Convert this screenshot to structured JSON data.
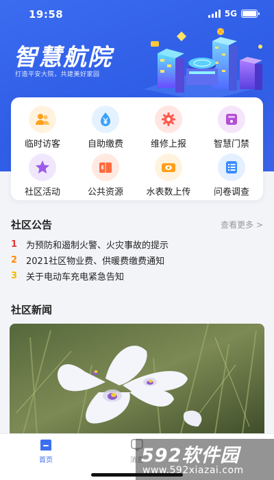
{
  "status": {
    "time": "19:58",
    "network": "5G"
  },
  "header": {
    "title": "智慧航院",
    "slogan": "打造平安大院，共建美好家园"
  },
  "quick_actions": [
    {
      "label": "临时访客",
      "icon": "visitor-icon",
      "color": "#ff9f1a",
      "bg": "#fff3df"
    },
    {
      "label": "自助缴费",
      "icon": "yen-payment-icon",
      "color": "#3aa1ff",
      "bg": "#e4f2ff"
    },
    {
      "label": "维修上报",
      "icon": "repair-gear-icon",
      "color": "#ff5a4e",
      "bg": "#ffe6e3"
    },
    {
      "label": "智慧门禁",
      "icon": "access-door-icon",
      "color": "#b34fd6",
      "bg": "#f5e5fb"
    },
    {
      "label": "社区活动",
      "icon": "star-activity-icon",
      "color": "#9c5ce8",
      "bg": "#f0e7fd"
    },
    {
      "label": "公共资源",
      "icon": "book-resource-icon",
      "color": "#ff6a3d",
      "bg": "#ffe9e0"
    },
    {
      "label": "水表数上传",
      "icon": "meter-icon",
      "color": "#ff9f1a",
      "bg": "#fff3df"
    },
    {
      "label": "问卷调查",
      "icon": "survey-list-icon",
      "color": "#3a8dff",
      "bg": "#e4efff"
    }
  ],
  "notices": {
    "title": "社区公告",
    "more": "查看更多 >",
    "items": [
      {
        "num": "1",
        "color": "#e53935",
        "text": "为预防和遏制火警、火灾事故的提示"
      },
      {
        "num": "2",
        "color": "#ff8a00",
        "text": "2021社区物业费、供暖费缴费通知"
      },
      {
        "num": "3",
        "color": "#f5b800",
        "text": "关于电动车充电紧急告知"
      }
    ]
  },
  "news": {
    "title": "社区新闻"
  },
  "tabbar": {
    "items": [
      {
        "label": "首页",
        "active": true
      },
      {
        "label": "消息",
        "active": false
      }
    ],
    "active_color": "#3c6ff0"
  },
  "watermark": {
    "main": "592软件园",
    "url": "www.592xiazai.com"
  }
}
